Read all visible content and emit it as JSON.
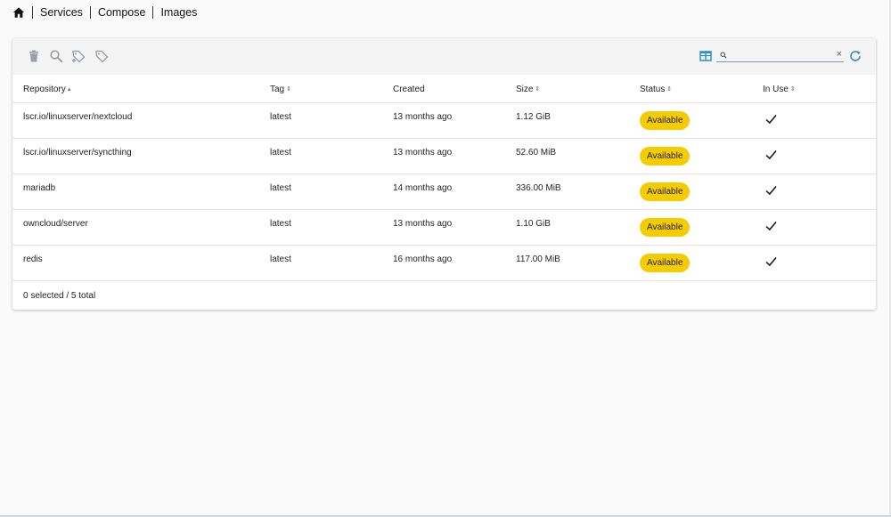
{
  "breadcrumb": {
    "home_icon": "home-icon",
    "items": [
      "Services",
      "Compose",
      "Images"
    ]
  },
  "toolbar": {
    "icons": [
      "trash-icon",
      "search-icon",
      "tag-add-icon",
      "tag-remove-icon"
    ],
    "view_icon": "table-view-icon",
    "refresh_icon": "refresh-icon",
    "search": {
      "value": "",
      "placeholder": "",
      "clear_label": "×"
    }
  },
  "colors": {
    "accent": "#2b8ec5",
    "status_available": "#f5cc00",
    "toolbar_bg": "#f4f4f4",
    "icon_gray": "#9aa0a6"
  },
  "table": {
    "columns": [
      {
        "label": "Repository",
        "sort": "▴"
      },
      {
        "label": "Tag",
        "sort": "⇕"
      },
      {
        "label": "Created",
        "sort": ""
      },
      {
        "label": "Size",
        "sort": "⇕"
      },
      {
        "label": "Status",
        "sort": "⇕"
      },
      {
        "label": "In Use",
        "sort": "⇕"
      }
    ],
    "rows": [
      {
        "repository": "lscr.io/linuxserver/nextcloud",
        "tag": "latest",
        "created": "13 months ago",
        "size": "1.12 GiB",
        "status": "Available",
        "in_use": "check-icon"
      },
      {
        "repository": "lscr.io/linuxserver/syncthing",
        "tag": "latest",
        "created": "13 months ago",
        "size": "52.60 MiB",
        "status": "Available",
        "in_use": "check-icon"
      },
      {
        "repository": "mariadb",
        "tag": "latest",
        "created": "14 months ago",
        "size": "336.00 MiB",
        "status": "Available",
        "in_use": "check-icon"
      },
      {
        "repository": "owncloud/server",
        "tag": "latest",
        "created": "13 months ago",
        "size": "1.10 GiB",
        "status": "Available",
        "in_use": "check-icon"
      },
      {
        "repository": "redis",
        "tag": "latest",
        "created": "16 months ago",
        "size": "117.00 MiB",
        "status": "Available",
        "in_use": "check-icon"
      }
    ],
    "footer": "0 selected / 5 total"
  }
}
